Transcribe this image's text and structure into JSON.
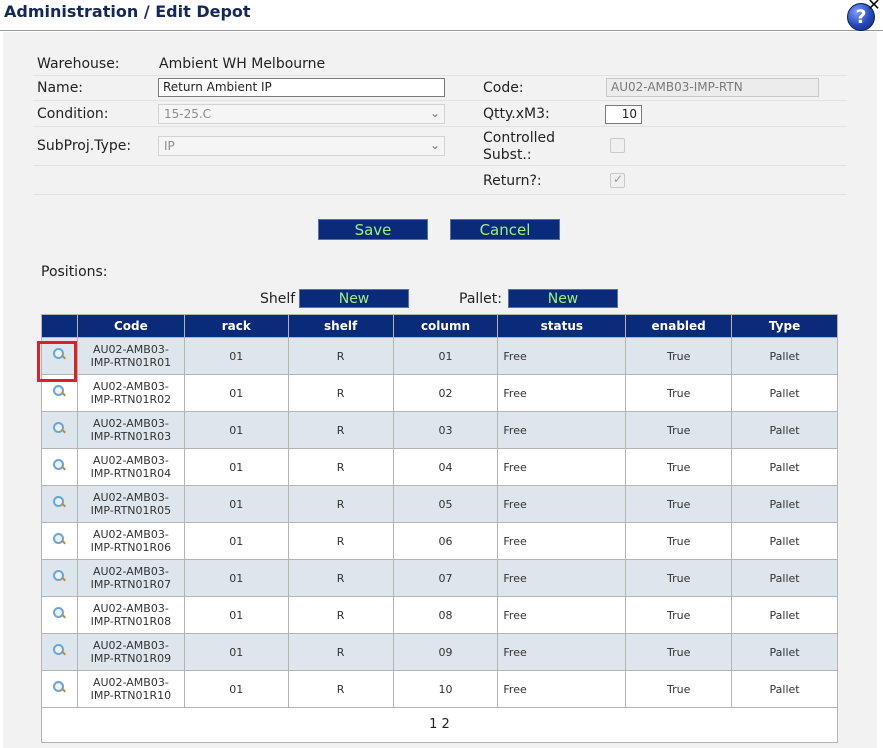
{
  "window": {
    "title": "Administration / Edit Depot",
    "help_label": "?",
    "close_label": "✕"
  },
  "form": {
    "warehouse_label": "Warehouse:",
    "warehouse_value": "Ambient WH Melbourne",
    "name_label": "Name:",
    "name_value": "Return Ambient IP",
    "code_label": "Code:",
    "code_value": "AU02-AMB03-IMP-RTN",
    "condition_label": "Condition:",
    "condition_value": "15-25.C",
    "qtty_label": "Qtty.xM3:",
    "qtty_value": "10",
    "subproj_label": "SubProj.Type:",
    "subproj_value": "IP",
    "controlled_label_1": "Controlled",
    "controlled_label_2": "Subst.:",
    "controlled_checked": false,
    "return_label": "Return?:",
    "return_checked": true
  },
  "actions": {
    "save_label": "Save",
    "cancel_label": "Cancel"
  },
  "positions": {
    "title": "Positions:",
    "shelf_label": "Shelf",
    "shelf_new_label": "New",
    "pallet_label": "Pallet:",
    "pallet_new_label": "New",
    "columns": [
      "",
      "Code",
      "rack",
      "shelf",
      "column",
      "status",
      "enabled",
      "Type"
    ],
    "rows": [
      {
        "code_1": "AU02-AMB03-",
        "code_2": "IMP-RTN01R01",
        "rack": "01",
        "shelf": "R",
        "column": "01",
        "status": "Free",
        "enabled": "True",
        "type": "Pallet"
      },
      {
        "code_1": "AU02-AMB03-",
        "code_2": "IMP-RTN01R02",
        "rack": "01",
        "shelf": "R",
        "column": "02",
        "status": "Free",
        "enabled": "True",
        "type": "Pallet"
      },
      {
        "code_1": "AU02-AMB03-",
        "code_2": "IMP-RTN01R03",
        "rack": "01",
        "shelf": "R",
        "column": "03",
        "status": "Free",
        "enabled": "True",
        "type": "Pallet"
      },
      {
        "code_1": "AU02-AMB03-",
        "code_2": "IMP-RTN01R04",
        "rack": "01",
        "shelf": "R",
        "column": "04",
        "status": "Free",
        "enabled": "True",
        "type": "Pallet"
      },
      {
        "code_1": "AU02-AMB03-",
        "code_2": "IMP-RTN01R05",
        "rack": "01",
        "shelf": "R",
        "column": "05",
        "status": "Free",
        "enabled": "True",
        "type": "Pallet"
      },
      {
        "code_1": "AU02-AMB03-",
        "code_2": "IMP-RTN01R06",
        "rack": "01",
        "shelf": "R",
        "column": "06",
        "status": "Free",
        "enabled": "True",
        "type": "Pallet"
      },
      {
        "code_1": "AU02-AMB03-",
        "code_2": "IMP-RTN01R07",
        "rack": "01",
        "shelf": "R",
        "column": "07",
        "status": "Free",
        "enabled": "True",
        "type": "Pallet"
      },
      {
        "code_1": "AU02-AMB03-",
        "code_2": "IMP-RTN01R08",
        "rack": "01",
        "shelf": "R",
        "column": "08",
        "status": "Free",
        "enabled": "True",
        "type": "Pallet"
      },
      {
        "code_1": "AU02-AMB03-",
        "code_2": "IMP-RTN01R09",
        "rack": "01",
        "shelf": "R",
        "column": "09",
        "status": "Free",
        "enabled": "True",
        "type": "Pallet"
      },
      {
        "code_1": "AU02-AMB03-",
        "code_2": "IMP-RTN01R10",
        "rack": "01",
        "shelf": "R",
        "column": "10",
        "status": "Free",
        "enabled": "True",
        "type": "Pallet"
      }
    ],
    "pager": "1 2"
  },
  "colors": {
    "header_bg": "#0a2a7a",
    "button_text": "#a0f07a",
    "highlight": "#e02020"
  }
}
